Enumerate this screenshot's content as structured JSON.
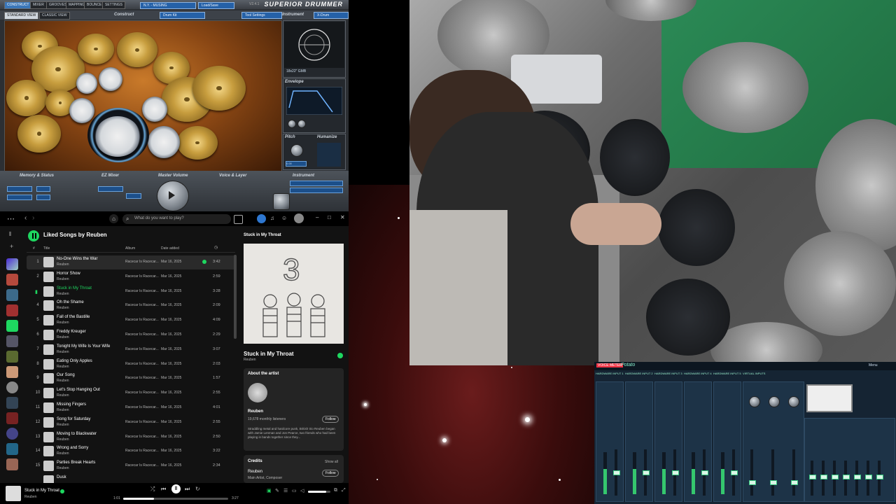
{
  "superior_drummer": {
    "app_title": "SUPERIOR DRUMMER",
    "version": "V2.4.1",
    "tabs": [
      "CONSTRUCT",
      "MIXER",
      "GROOVES",
      "MAPPING",
      "BOUNCE",
      "SETTINGS"
    ],
    "preset": "N.Y. - MUSING",
    "load_save": "Load/Save",
    "views": [
      "STANDARD VIEW",
      "CLASSIC VIEW"
    ],
    "construct_label": "Construct",
    "drumkit": "Drum Kit",
    "tool_settings": "Tool Settings",
    "instrument_label": "Instrument",
    "instrument_value": "X-Drum",
    "kick_name": "18x22\" GMB",
    "envelope_label": "Envelope",
    "pitch_label": "Pitch",
    "humanize_label": "Humanize",
    "pitch_value": "0.00",
    "section_labels": [
      "Memory & Status",
      "EZ Mixer",
      "Master Volume",
      "Voice & Layer",
      "Instrument"
    ]
  },
  "spotify": {
    "search_placeholder": "What do you want to play?",
    "playlist_title": "Liked Songs by Reuben",
    "columns": {
      "num": "#",
      "title": "Title",
      "album": "Album",
      "date": "Date added"
    },
    "tracks": [
      {
        "num": "1",
        "title": "No-One Wins the War",
        "artist": "Reuben",
        "album": "Racecar Is Racecar...",
        "date": "Mar 16, 2025",
        "duration": "3:42"
      },
      {
        "num": "2",
        "title": "Horror Show",
        "artist": "Reuben",
        "album": "Racecar Is Racecar...",
        "date": "Mar 16, 2025",
        "duration": "2:59"
      },
      {
        "num": "",
        "title": "Stuck in My Throat",
        "artist": "Reuben",
        "album": "Racecar Is Racecar...",
        "date": "Mar 16, 2025",
        "duration": "3:28"
      },
      {
        "num": "4",
        "title": "Oh the Shame",
        "artist": "Reuben",
        "album": "Racecar Is Racecar...",
        "date": "Mar 16, 2025",
        "duration": "2:09"
      },
      {
        "num": "5",
        "title": "Fall of the Bastille",
        "artist": "Reuben",
        "album": "Racecar Is Racecar...",
        "date": "Mar 16, 2025",
        "duration": "4:09"
      },
      {
        "num": "6",
        "title": "Freddy Kreuger",
        "artist": "Reuben",
        "album": "Racecar Is Racecar...",
        "date": "Mar 16, 2025",
        "duration": "2:29"
      },
      {
        "num": "7",
        "title": "Tonight My Wife Is Your Wife",
        "artist": "Reuben",
        "album": "Racecar Is Racecar...",
        "date": "Mar 16, 2025",
        "duration": "3:07"
      },
      {
        "num": "8",
        "title": "Eating Only Apples",
        "artist": "Reuben",
        "album": "Racecar Is Racecar...",
        "date": "Mar 16, 2025",
        "duration": "2:03"
      },
      {
        "num": "9",
        "title": "Our Song",
        "artist": "Reuben",
        "album": "Racecar Is Racecar...",
        "date": "Mar 16, 2025",
        "duration": "1:57"
      },
      {
        "num": "10",
        "title": "Let's Stop Hanging Out",
        "artist": "Reuben",
        "album": "Racecar Is Racecar...",
        "date": "Mar 16, 2025",
        "duration": "2:55"
      },
      {
        "num": "11",
        "title": "Missing Fingers",
        "artist": "Reuben",
        "album": "Racecar Is Racecar...",
        "date": "Mar 16, 2025",
        "duration": "4:01"
      },
      {
        "num": "12",
        "title": "Song for Saturday",
        "artist": "Reuben",
        "album": "Racecar Is Racecar...",
        "date": "Mar 16, 2025",
        "duration": "2:55"
      },
      {
        "num": "13",
        "title": "Moving to Blackwater",
        "artist": "Reuben",
        "album": "Racecar Is Racecar...",
        "date": "Mar 16, 2025",
        "duration": "2:50"
      },
      {
        "num": "14",
        "title": "Wrong and Sorry",
        "artist": "Reuben",
        "album": "Racecar Is Racecar...",
        "date": "Mar 16, 2025",
        "duration": "3:22"
      },
      {
        "num": "15",
        "title": "Parties Break Hearts",
        "artist": "Reuben",
        "album": "Racecar Is Racecar...",
        "date": "Mar 16, 2025",
        "duration": "2:34"
      },
      {
        "num": "",
        "title": "Dusk",
        "artist": "",
        "album": "",
        "date": "",
        "duration": ""
      }
    ],
    "now_playing_panel": {
      "header": "Stuck in My Throat",
      "song_title": "Stuck in My Throat",
      "artist": "Reuben",
      "about_label": "About the artist",
      "artist_name": "Reuben",
      "listeners": "19,678 monthly listeners",
      "follow": "Follow",
      "bio": "Straddling metal and hardcore punk, British trio Reuben began with Jamie Lenman and Jon Pearce, two friends who had been playing in bands together since they...",
      "credits_label": "Credits",
      "show_all": "Show all",
      "credit_name": "Reuben",
      "credit_role": "Main Artist, Composer"
    },
    "player": {
      "title": "Stuck in My Throat",
      "artist": "Reuben",
      "elapsed": "1:01",
      "total": "3:27",
      "progress": 0.29
    },
    "colors": {
      "accent": "#1ed760"
    }
  },
  "mixer": {
    "brand": "VOICE METER",
    "product": "Potato",
    "inputs": [
      "HARDWARE INPUT 1",
      "HARDWARE INPUT 2",
      "HARDWARE INPUT 3",
      "HARDWARE INPUT 4",
      "HARDWARE INPUT 5",
      "VIRTUAL INPUTS"
    ],
    "menu": "Menu"
  }
}
